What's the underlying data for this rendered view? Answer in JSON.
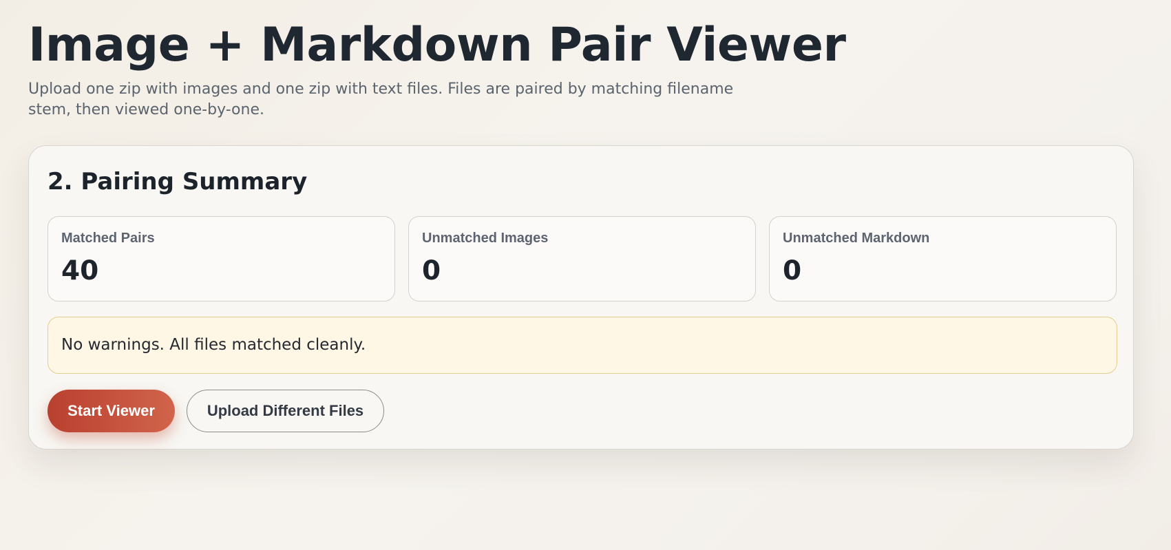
{
  "header": {
    "title": "Image + Markdown Pair Viewer",
    "subtitle": "Upload one zip with images and one zip with text files. Files are paired by matching filename stem, then viewed one-by-one."
  },
  "summary": {
    "title": "2. Pairing Summary",
    "stats": [
      {
        "label": "Matched Pairs",
        "value": "40"
      },
      {
        "label": "Unmatched Images",
        "value": "0"
      },
      {
        "label": "Unmatched Markdown",
        "value": "0"
      }
    ],
    "notice": "No warnings. All files matched cleanly.",
    "buttons": {
      "start": "Start Viewer",
      "upload": "Upload Different Files"
    }
  },
  "colors": {
    "accent": "#c4503b",
    "notice_bg": "#fef7e6",
    "notice_border": "#e6cd8f"
  }
}
